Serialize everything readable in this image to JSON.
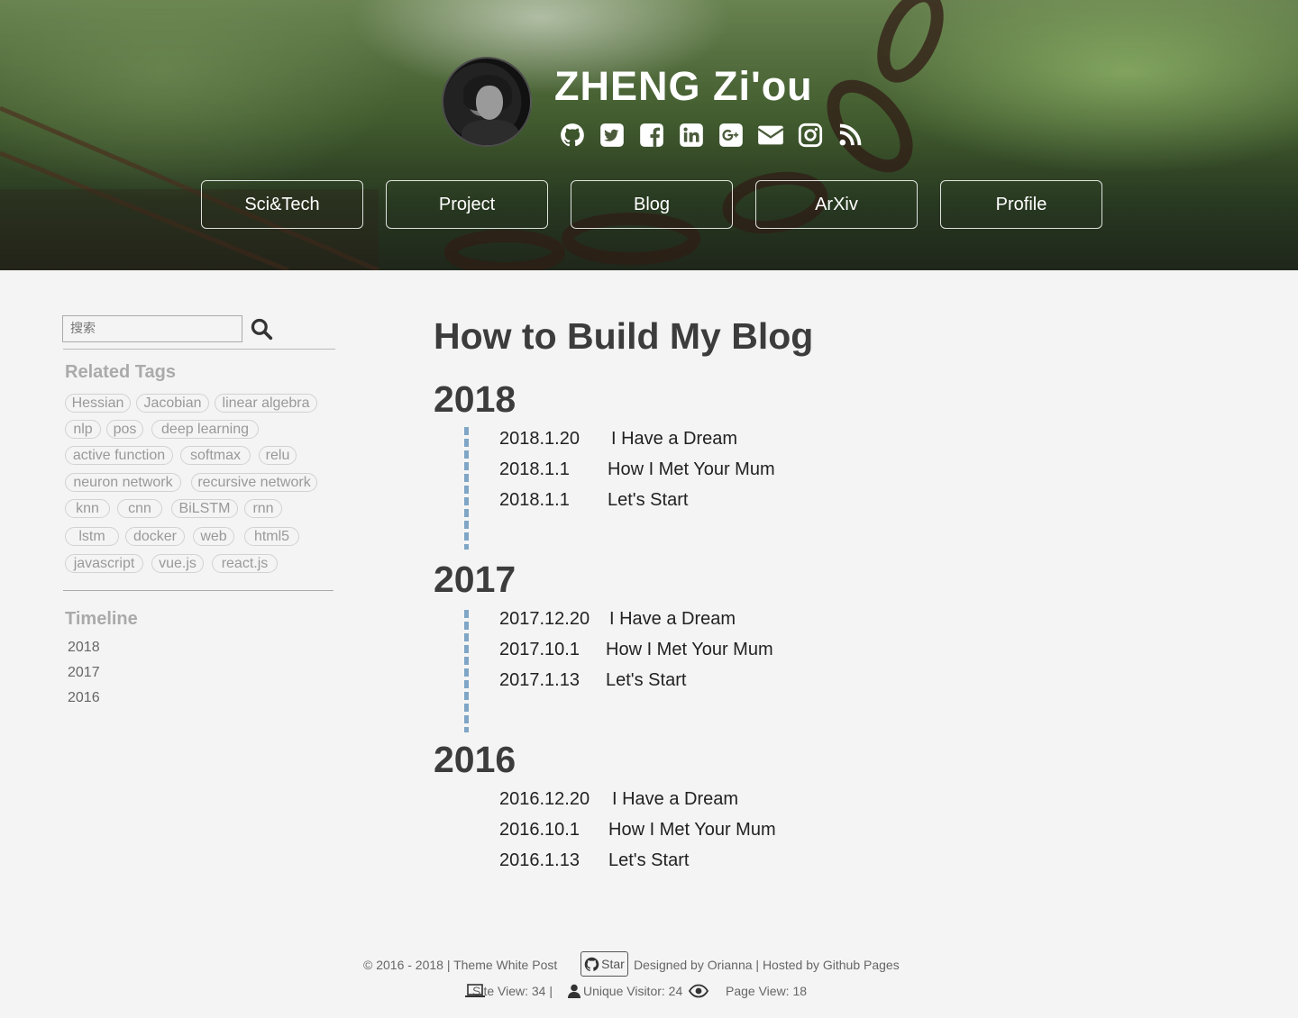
{
  "header": {
    "site_title": "ZHENG Zi'ou",
    "social_icons": [
      "github-icon",
      "twitter-icon",
      "facebook-icon",
      "linkedin-icon",
      "google-plus-icon",
      "email-icon",
      "instagram-icon",
      "rss-icon"
    ],
    "nav": [
      {
        "label": "Sci&Tech"
      },
      {
        "label": "Project"
      },
      {
        "label": "Blog"
      },
      {
        "label": "ArXiv"
      },
      {
        "label": "Profile"
      }
    ]
  },
  "sidebar": {
    "search_placeholder": "搜索",
    "related_tags_heading": "Related Tags",
    "tags": [
      "Hessian",
      "Jacobian",
      "linear algebra",
      "nlp",
      "pos",
      "deep learning",
      "active function",
      "softmax",
      "relu",
      "neuron network",
      "recursive network",
      "knn",
      "cnn",
      "BiLSTM",
      "rnn",
      "lstm",
      "docker",
      "web",
      "html5",
      "javascript",
      "vue.js",
      "react.js"
    ],
    "timeline_heading": "Timeline",
    "timeline_years": [
      "2018",
      "2017",
      "2016"
    ]
  },
  "main": {
    "title": "How to Build My Blog",
    "groups": [
      {
        "year": "2018",
        "posts": [
          {
            "date": "2018.1.20",
            "title": "I Have a Dream"
          },
          {
            "date": "2018.1.1",
            "title": "How I Met Your Mum"
          },
          {
            "date": "2018.1.1",
            "title": "Let's Start"
          }
        ]
      },
      {
        "year": "2017",
        "posts": [
          {
            "date": "2017.12.20",
            "title": "I Have a Dream"
          },
          {
            "date": "2017.10.1",
            "title": "How I Met Your Mum"
          },
          {
            "date": "2017.1.13",
            "title": "Let's Start"
          }
        ]
      },
      {
        "year": "2016",
        "posts": [
          {
            "date": "2016.12.20",
            "title": "I Have a Dream"
          },
          {
            "date": "2016.10.1",
            "title": "How I Met Your Mum"
          },
          {
            "date": "2016.1.13",
            "title": "Let's Start"
          }
        ]
      }
    ]
  },
  "footer": {
    "copyright": "© 2016 - 2018 | Theme White Post",
    "star_label": "Star",
    "designed_by": "Designed by Orianna |  Hosted by Github Pages",
    "site_view": "Site View: 34 |",
    "unique_visitor": "Unique Visitor: 24",
    "page_view": "Page View: 18"
  },
  "colors": {
    "timeline_line": "#7fa6c6",
    "page_background": "#f4f4f4",
    "heading": "#3c3c3c"
  }
}
